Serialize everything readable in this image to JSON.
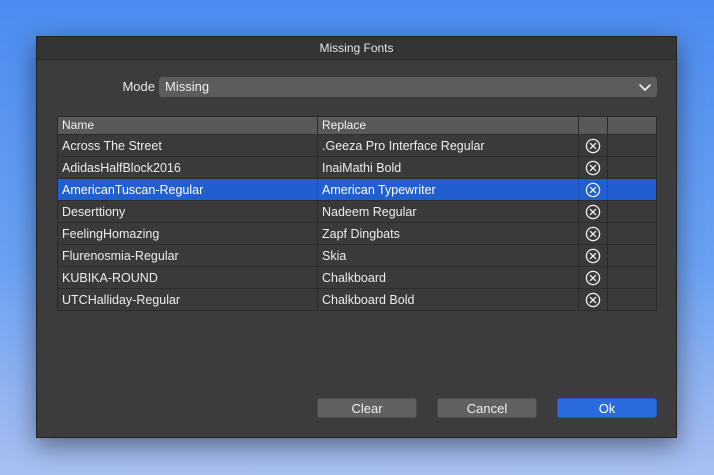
{
  "dialog": {
    "title": "Missing Fonts"
  },
  "mode": {
    "label": "Mode",
    "selected": "Missing"
  },
  "table": {
    "columns": [
      "Name",
      "Replace",
      "",
      ""
    ],
    "rows": [
      {
        "name": "Across The Street",
        "replace": ".Geeza Pro Interface Regular"
      },
      {
        "name": "AdidasHalfBlock2016",
        "replace": "InaiMathi Bold"
      },
      {
        "name": "AmericanTuscan-Regular",
        "replace": "American Typewriter"
      },
      {
        "name": "Deserttiony",
        "replace": "Nadeem Regular"
      },
      {
        "name": "FeelingHomazing",
        "replace": "Zapf Dingbats"
      },
      {
        "name": "Flurenosmia-Regular",
        "replace": "Skia"
      },
      {
        "name": "KUBIKA-ROUND",
        "replace": "Chalkboard"
      },
      {
        "name": "UTCHalliday-Regular",
        "replace": "Chalkboard Bold"
      }
    ],
    "selected_row": 2
  },
  "buttons": {
    "clear": "Clear",
    "cancel": "Cancel",
    "ok": "Ok"
  },
  "colors": {
    "selection": "#1f5fd0",
    "ok_button": "#2b6be0",
    "dialog_bg": "#3c3c3c"
  },
  "icons": {
    "remove": "circle-x-icon",
    "dropdown": "chevron-down-icon"
  }
}
